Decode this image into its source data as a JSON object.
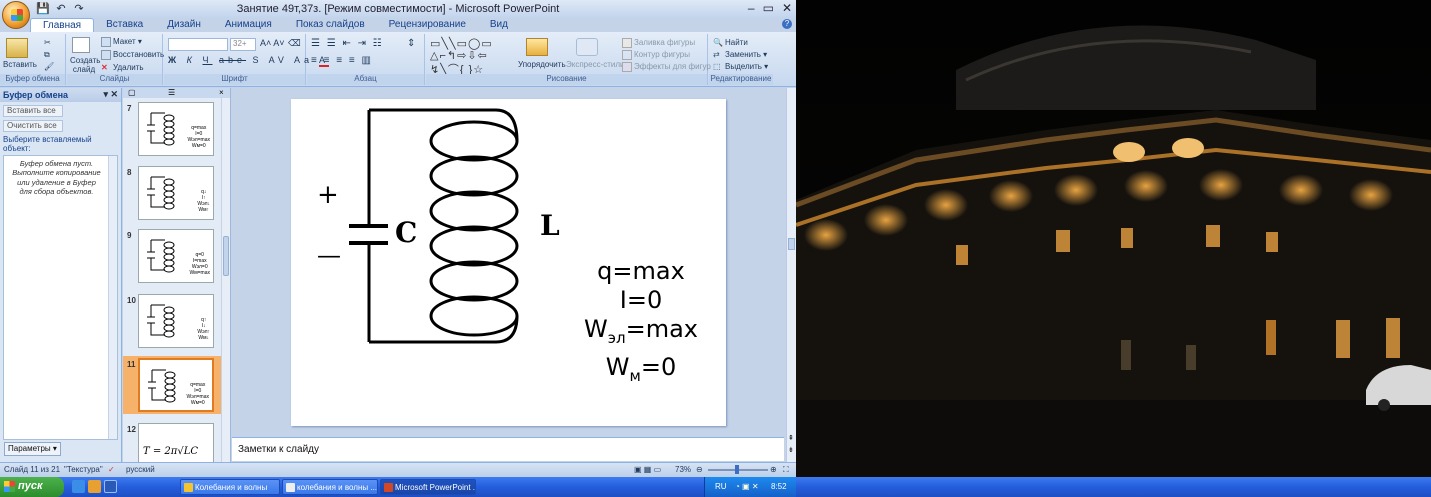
{
  "window": {
    "title": "Занятие 49т,37з. [Режим совместимости] - Microsoft PowerPoint",
    "controls": [
      "–",
      "▭",
      "✕"
    ]
  },
  "qat": {
    "save": "💾",
    "undo": "↶",
    "redo": "↷"
  },
  "tabs": [
    "Главная",
    "Вставка",
    "Дизайн",
    "Анимация",
    "Показ слайдов",
    "Рецензирование",
    "Вид"
  ],
  "ribbon": {
    "clipboard": {
      "label": "Буфер обмена",
      "paste": "Вставить"
    },
    "slides": {
      "label": "Слайды",
      "create": "Создать слайд",
      "layout": "Макет",
      "restore": "Восстановить",
      "delete": "Удалить"
    },
    "font": {
      "label": "Шрифт",
      "size": "32+",
      "bold": "Ж",
      "italic": "К",
      "underline": "Ч",
      "strike": "abe",
      "shadow": "S",
      "spacing": "AV",
      "case": "Aa",
      "color": "A"
    },
    "paragraph": {
      "label": "Абзац"
    },
    "drawing": {
      "label": "Рисование",
      "arrange": "Упорядочить",
      "quick_styles": "Экспресс-стили",
      "fill": "Заливка фигуры",
      "outline": "Контур фигуры",
      "effects": "Эффекты для фигур"
    },
    "editing": {
      "label": "Редактирование",
      "find": "Найти",
      "replace": "Заменить",
      "select": "Выделить"
    }
  },
  "clipboard_pane": {
    "title": "Буфер обмена",
    "paste_all": "Вставить все",
    "clear_all": "Очистить все",
    "select_label": "Выберите вставляемый объект:",
    "empty_text": "Буфер обмена пуст. Выполните копирование или удаление в Буфер для сбора объектов.",
    "params": "Параметры ▾"
  },
  "thumbnails": [
    {
      "num": "7",
      "text": "q=max\nI=0\nWэл=max\nWм=0"
    },
    {
      "num": "8",
      "text": "q↓\nI↑\nWэл↓\nWм↑"
    },
    {
      "num": "9",
      "text": "q=0\nI=max\nWэл=0\nWм=max"
    },
    {
      "num": "10",
      "text": "q↑\nI↓\nWэл↑\nWм↓"
    },
    {
      "num": "11",
      "text": "q=max\nI=0\nWэл=max\nWм=0",
      "selected": true
    },
    {
      "num": "12",
      "text": "T = 2π√LC"
    }
  ],
  "slide": {
    "plus": "+",
    "minus": "—",
    "cap_label": "C",
    "ind_label": "L",
    "line1": "q=max",
    "line2": "I=0",
    "line3_main": "W",
    "line3_sub": "эл",
    "line3_rest": "=max",
    "line4_main": "W",
    "line4_sub": "м",
    "line4_rest": "=0"
  },
  "notes": {
    "placeholder": "Заметки к слайду"
  },
  "status": {
    "slide_info": "Слайд 11 из 21",
    "theme": "\"Текстура\"",
    "language": "русский",
    "zoom": "73%"
  },
  "taskbar": {
    "start": "пуск",
    "tasks": [
      "Колебания и волны",
      "колебания и волны ...",
      "Microsoft PowerPoint ..."
    ],
    "lang": "RU",
    "time": "8:52"
  }
}
